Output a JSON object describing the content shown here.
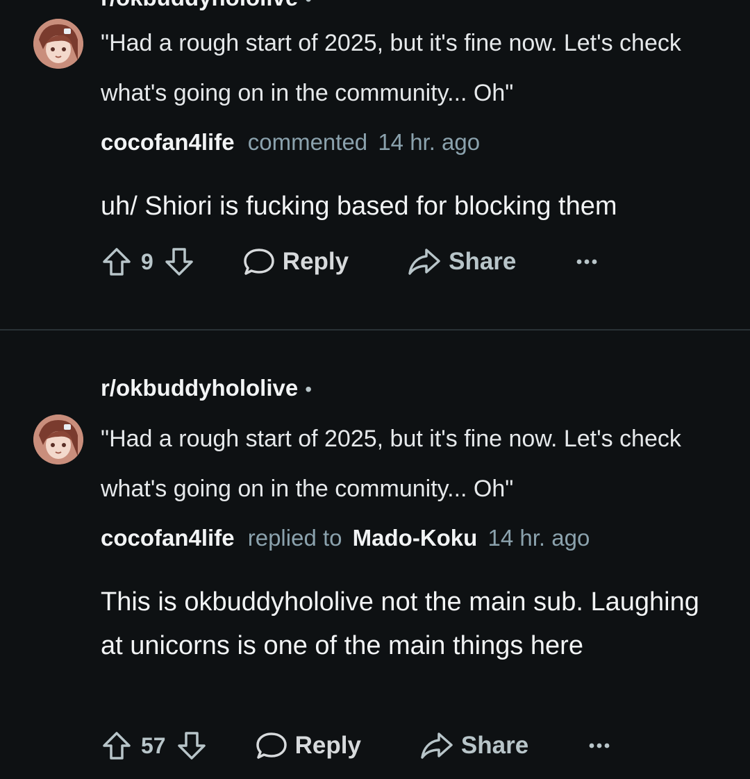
{
  "comments": [
    {
      "subreddit": "r/okbuddyhololive",
      "separator": "•",
      "post_title": "\"Had a rough start of 2025, but it's fine now. Let's check what's going on in the community... Oh\"",
      "author": "cocofan4life",
      "action": "commented",
      "reply_target": "",
      "time": "14 hr. ago",
      "body": "uh/ Shiori is fucking based for blocking them",
      "score": "9",
      "reply_label": "Reply",
      "share_label": "Share"
    },
    {
      "subreddit": "r/okbuddyhololive",
      "separator": "•",
      "post_title": "\"Had a rough start of 2025, but it's fine now. Let's check what's going on in the community... Oh\"",
      "author": "cocofan4life",
      "action": "replied to",
      "reply_target": "Mado-Koku",
      "time": "14 hr. ago",
      "body": "This is okbuddyhololive not the main sub. Laughing at unicorns is one of the main things here",
      "score": "57",
      "reply_label": "Reply",
      "share_label": "Share"
    }
  ],
  "icons": {
    "upvote": "upvote-arrow-icon",
    "downvote": "downvote-arrow-icon",
    "reply": "speech-bubble-icon",
    "share": "share-arrow-icon",
    "more": "ellipsis-icon"
  },
  "colors": {
    "background": "#0e1113",
    "text_primary": "#f2f4f5",
    "text_secondary": "#8ba2ad",
    "divider": "#2a3236"
  }
}
